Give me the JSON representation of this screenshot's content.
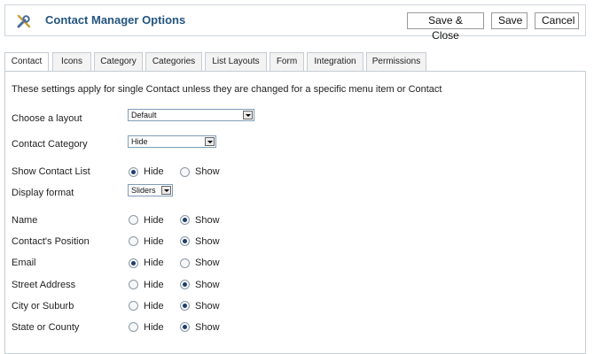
{
  "header": {
    "title": "Contact Manager Options",
    "buttons": {
      "save_close": "Save & Close",
      "save": "Save",
      "cancel": "Cancel"
    }
  },
  "tabs": [
    "Contact",
    "Icons",
    "Category",
    "Categories",
    "List Layouts",
    "Form",
    "Integration",
    "Permissions"
  ],
  "active_tab": "Contact",
  "description": "These settings apply for single Contact unless they are changed for a specific menu item or Contact",
  "fields": {
    "layout": {
      "label": "Choose a layout",
      "value": "Default"
    },
    "contact_category": {
      "label": "Contact Category",
      "value": "Hide"
    },
    "show_contact_list": {
      "label": "Show Contact List",
      "hide": "Hide",
      "show": "Show",
      "selected": "Hide"
    },
    "display_format": {
      "label": "Display format",
      "value": "Sliders"
    },
    "name": {
      "label": "Name",
      "hide": "Hide",
      "show": "Show",
      "selected": "Show"
    },
    "position": {
      "label": "Contact's Position",
      "hide": "Hide",
      "show": "Show",
      "selected": "Show"
    },
    "email": {
      "label": "Email",
      "hide": "Hide",
      "show": "Show",
      "selected": "Hide"
    },
    "street": {
      "label": "Street Address",
      "hide": "Hide",
      "show": "Show",
      "selected": "Show"
    },
    "city": {
      "label": "City or Suburb",
      "hide": "Hide",
      "show": "Show",
      "selected": "Show"
    },
    "state": {
      "label": "State or County",
      "hide": "Hide",
      "show": "Show",
      "selected": "Show"
    }
  },
  "colors": {
    "title": "#24557f",
    "radio_dot": "#1f3d6b",
    "border": "#c5ccd3"
  },
  "icons": {
    "header_icon": "wrench-screwdriver-icon"
  }
}
